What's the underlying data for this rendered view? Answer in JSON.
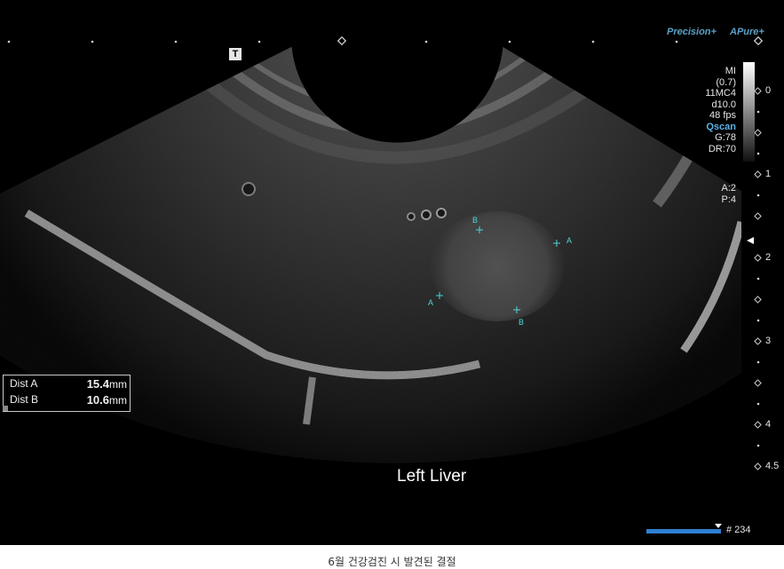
{
  "brand": {
    "precision": "Precision+",
    "apure": "APure+"
  },
  "marker_t": "T",
  "params": {
    "mi_label": "MI",
    "mi_value": "(0.7)",
    "probe": "11MC4",
    "depth": "d10.0",
    "fps": "48 fps",
    "qscan": "Qscan",
    "gain": "G:78",
    "dr": "DR:70",
    "a": "A:2",
    "p": "P:4"
  },
  "depth_scale": [
    "0",
    "1",
    "2",
    "3",
    "4",
    "4.5"
  ],
  "measurements": [
    {
      "label": "Dist A",
      "value": "15.4",
      "unit": "mm"
    },
    {
      "label": "Dist B",
      "value": "10.6",
      "unit": "mm"
    }
  ],
  "calipers": {
    "a": "A",
    "b": "B"
  },
  "region_label": "Left Liver",
  "frame": {
    "number": "# 234"
  },
  "caption": "6월 건강검진 시 발견된 결절",
  "colors": {
    "caliper": "#4fd6d6",
    "frame_bar": "#2f7fd2",
    "brand": "#5aa2c8",
    "qscan": "#59b4e8"
  }
}
